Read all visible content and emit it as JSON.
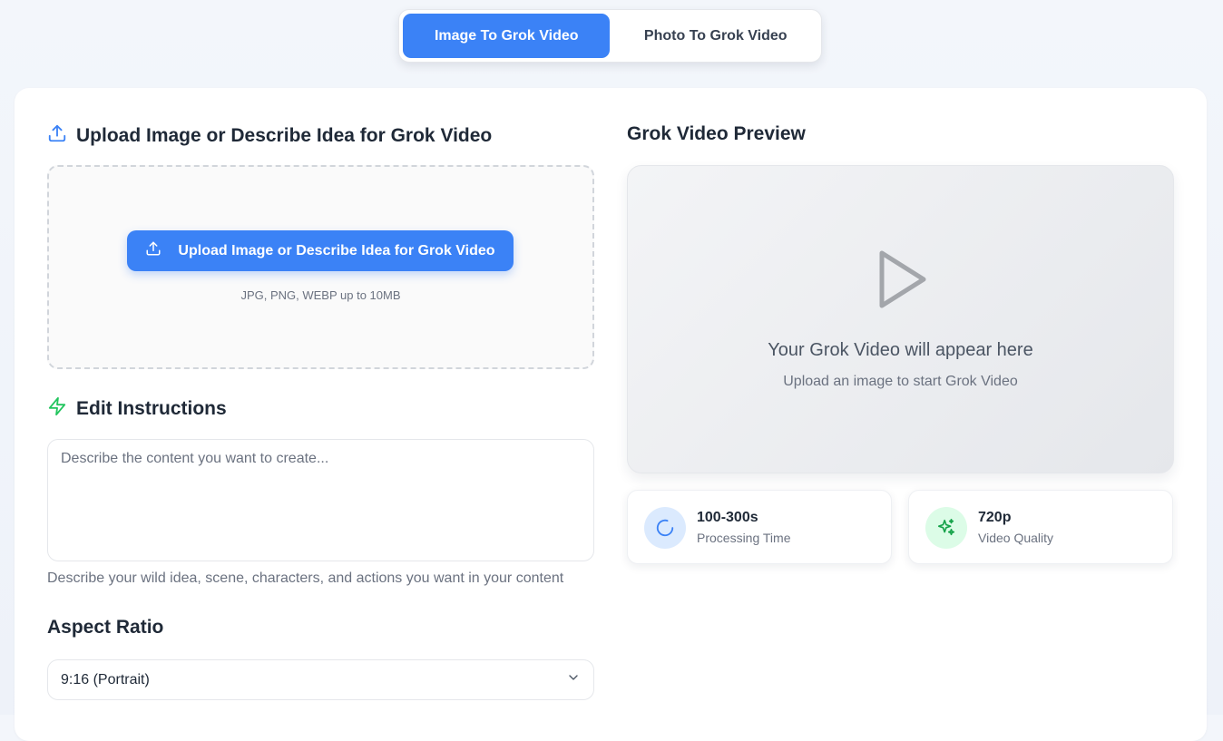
{
  "tabs": [
    {
      "label": "Image To Grok Video",
      "active": true
    },
    {
      "label": "Photo To Grok Video",
      "active": false
    }
  ],
  "upload": {
    "title": "Upload Image or Describe Idea for Grok Video",
    "button_label": "Upload Image or Describe Idea for Grok Video",
    "formats": "JPG, PNG, WEBP up to 10MB"
  },
  "instructions": {
    "title": "Edit Instructions",
    "placeholder": "Describe the content you want to create...",
    "value": "",
    "hint": "Describe your wild idea, scene, characters, and actions you want in your content"
  },
  "aspect": {
    "title": "Aspect Ratio",
    "selected": "9:16 (Portrait)"
  },
  "preview": {
    "title": "Grok Video Preview",
    "placeholder_title": "Your Grok Video will appear here",
    "placeholder_sub": "Upload an image to start Grok Video"
  },
  "stats": [
    {
      "value": "100-300s",
      "label": "Processing Time",
      "icon": "loader-icon"
    },
    {
      "value": "720p",
      "label": "Video Quality",
      "icon": "sparkles-icon"
    }
  ],
  "colors": {
    "accent": "#3b82f6",
    "green": "#22c55e",
    "stat_blue_bg": "#dbeafe",
    "stat_green_bg": "#dcfce7"
  }
}
